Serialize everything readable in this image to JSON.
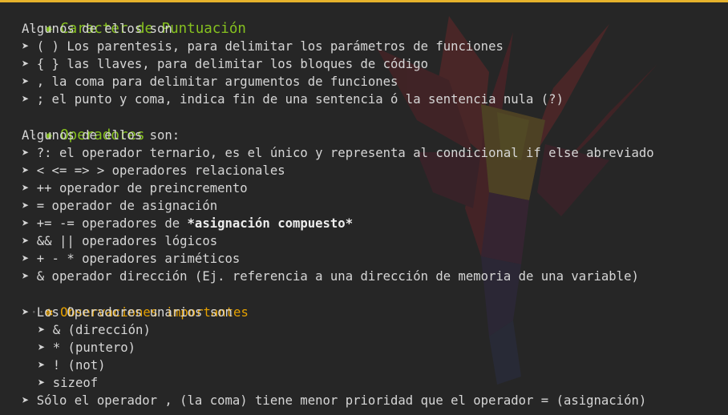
{
  "colors": {
    "background": "#262626",
    "heading_green": "#86c11f",
    "heading_orange": "#e6a100",
    "text": "#d6d6d6",
    "top_accent": "#e6b22c"
  },
  "icons": {
    "bullet": "heading-asterisk-icon",
    "list": "arrowhead-icon"
  },
  "sections": {
    "puntuacion": {
      "title": "Caracter de Puntuación",
      "intro": "Algunos de ellos son",
      "items": [
        "( ) Los parentesis, para delimitar los parámetros de funciones",
        "{ } las llaves, para delimitar los bloques de código",
        ", la coma para delimitar argumentos de funciones",
        "; el punto y coma, indica fin de una sentencia ó la sentencia nula (?)"
      ]
    },
    "operadores": {
      "title": "Operadores",
      "intro": "Algunos de ellos son:",
      "items": [
        "?: el operador ternario, es el único y representa al condicional if else abreviado",
        "< <= => > operadores relacionales",
        "++ operador de preincremento",
        "= operador de asignación",
        "+= -= operadores de ",
        "&& || operadores lógicos",
        "+ - * operadores ariméticos",
        "& operador dirección (Ej. referencia a una dirección de memoria de una variable)"
      ],
      "bold_fragment": "*asignación compuesto*"
    },
    "observaciones": {
      "title": "Observaciones importantes",
      "unarios_label": "Los Operadores unarios son",
      "unarios": [
        "& (dirección)",
        "* (puntero)",
        "! (not)",
        "sizeof"
      ],
      "nota": "Sólo el operador , (la coma) tiene menor prioridad que el operador = (asignación)"
    }
  }
}
